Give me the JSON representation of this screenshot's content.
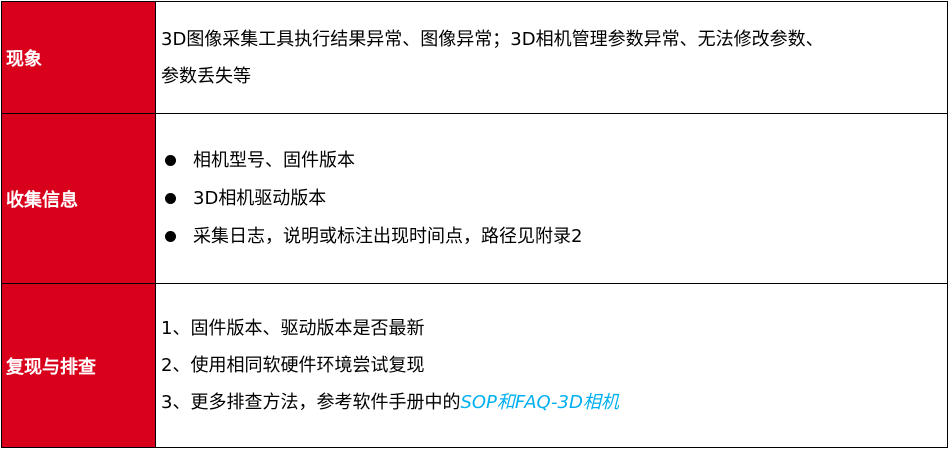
{
  "colors": {
    "label_background": "#d9001b",
    "label_text": "#ffffff",
    "border": "#000000",
    "link": "#00b0f0"
  },
  "rows": {
    "symptom": {
      "label": "现象",
      "text_line1": "3D图像采集工具执行结果异常、图像异常；3D相机管理参数异常、无法修改参数、",
      "text_line2": "参数丢失等"
    },
    "collect": {
      "label": "收集信息",
      "items": [
        "相机型号、固件版本",
        "3D相机驱动版本",
        "采集日志，说明或标注出现时间点，路径见附录2"
      ]
    },
    "reproduce": {
      "label": "复现与排查",
      "steps": [
        "1、固件版本、驱动版本是否最新",
        "2、使用相同软硬件环境尝试复现"
      ],
      "step3_prefix": "3、更多排查方法，参考软件手册中的",
      "step3_link": "SOP和FAQ-3D相机"
    }
  }
}
